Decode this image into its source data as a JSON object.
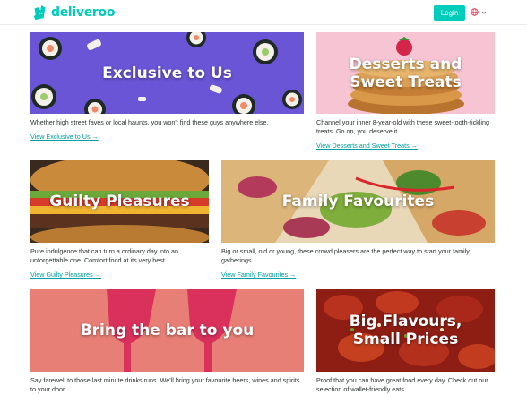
{
  "header": {
    "brand": "deliveroo",
    "login_label": "Login"
  },
  "cards": [
    {
      "title": "Exclusive to Us",
      "description": "Whether high street faves or local haunts, you won't find these guys anywhere else.",
      "link": "View Exclusive to Us →"
    },
    {
      "title": "Desserts and Sweet Treats",
      "description": "Channel your inner 8-year-old with these sweet-tooth-tickling treats. Go on, you deserve it.",
      "link": "View Desserts and Sweet Treats →"
    },
    {
      "title": "Guilty Pleasures",
      "description": "Pure indulgence that can turn a ordinary day into an unforgettable one. Comfort food at its very best.",
      "link": "View Guilty Pleasures →"
    },
    {
      "title": "Family Favourites",
      "description": "Big or small, old or young, these crowd pleasers are the perfect way to start your family gatherings.",
      "link": "View Family Favourites →"
    },
    {
      "title": "Bring the bar to you",
      "description": "Say farewell to those last minute drinks runs. We'll bring your favourite beers, wines and spirits to your door.",
      "link": ""
    },
    {
      "title": "Big Flavours, Small Prices",
      "description": "Proof that you can have great food every day. Check out our selection of wallet-friendly eats.",
      "link": ""
    }
  ],
  "colors": {
    "brand_teal": "#00ccbc",
    "link_teal": "#00a0a0",
    "exclusive_bg": "#6a55d6",
    "desserts_bg": "#f6c4d3",
    "bar_bg": "#e87f76",
    "flavours_bg": "#8e1e14"
  },
  "icons": {
    "logo": "kangaroo-logo-icon",
    "language": "globe-icon",
    "dropdown": "chevron-down-icon"
  }
}
